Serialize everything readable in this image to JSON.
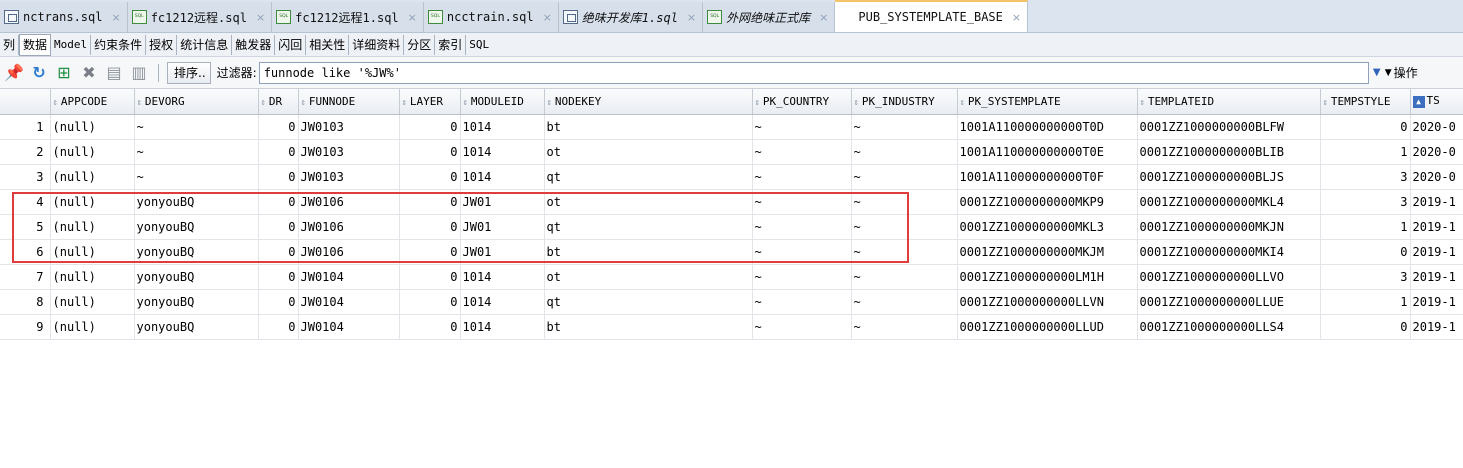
{
  "tabs": [
    {
      "label": "nctrans.sql",
      "icon": "doc-icon",
      "italic": false,
      "active": false
    },
    {
      "label": "fc1212远程.sql",
      "icon": "sql-icon",
      "italic": false,
      "active": false
    },
    {
      "label": "fc1212远程1.sql",
      "icon": "sql-icon",
      "italic": false,
      "active": false
    },
    {
      "label": "ncctrain.sql",
      "icon": "sql-icon",
      "italic": false,
      "active": false
    },
    {
      "label": "绝味开发库1.sql",
      "icon": "doc-icon",
      "italic": true,
      "active": false
    },
    {
      "label": "外网绝味正式库",
      "icon": "sql-icon",
      "italic": true,
      "active": false
    },
    {
      "label": "PUB_SYSTEMPLATE_BASE",
      "icon": "grid-icon",
      "italic": false,
      "active": true
    }
  ],
  "tab_close_glyph": "×",
  "subtabs": [
    "列",
    "数据",
    "Model",
    "约束条件",
    "授权",
    "统计信息",
    "触发器",
    "闪回",
    "相关性",
    "详细资料",
    "分区",
    "索引",
    "SQL"
  ],
  "toolbar": {
    "sort_label": "排序..",
    "filter_label": "过滤器:",
    "filter_value": "funnode like '%JW%'",
    "actions_label": "操作"
  },
  "grid": {
    "columns": [
      "APPCODE",
      "DEVORG",
      "DR",
      "FUNNODE",
      "LAYER",
      "MODULEID",
      "NODEKEY",
      "PK_COUNTRY",
      "PK_INDUSTRY",
      "PK_SYSTEMPLATE",
      "TEMPLATEID",
      "TEMPSTYLE",
      "TS"
    ],
    "rows": [
      {
        "n": "1",
        "cells": [
          "(null)",
          "~",
          "0",
          "JW0103",
          "0",
          "1014",
          "bt",
          "~",
          "~",
          "1001A110000000000T0D",
          "0001ZZ1000000000BLFW",
          "0",
          "2020-0"
        ]
      },
      {
        "n": "2",
        "cells": [
          "(null)",
          "~",
          "0",
          "JW0103",
          "0",
          "1014",
          "ot",
          "~",
          "~",
          "1001A110000000000T0E",
          "0001ZZ1000000000BLIB",
          "1",
          "2020-0"
        ]
      },
      {
        "n": "3",
        "cells": [
          "(null)",
          "~",
          "0",
          "JW0103",
          "0",
          "1014",
          "qt",
          "~",
          "~",
          "1001A110000000000T0F",
          "0001ZZ1000000000BLJS",
          "3",
          "2020-0"
        ]
      },
      {
        "n": "4",
        "cells": [
          "(null)",
          "yonyouBQ",
          "0",
          "JW0106",
          "0",
          "JW01",
          "ot",
          "~",
          "~",
          "0001ZZ1000000000MKP9",
          "0001ZZ1000000000MKL4",
          "3",
          "2019-1"
        ]
      },
      {
        "n": "5",
        "cells": [
          "(null)",
          "yonyouBQ",
          "0",
          "JW0106",
          "0",
          "JW01",
          "qt",
          "~",
          "~",
          "0001ZZ1000000000MKL3",
          "0001ZZ1000000000MKJN",
          "1",
          "2019-1"
        ]
      },
      {
        "n": "6",
        "cells": [
          "(null)",
          "yonyouBQ",
          "0",
          "JW0106",
          "0",
          "JW01",
          "bt",
          "~",
          "~",
          "0001ZZ1000000000MKJM",
          "0001ZZ1000000000MKI4",
          "0",
          "2019-1"
        ]
      },
      {
        "n": "7",
        "cells": [
          "(null)",
          "yonyouBQ",
          "0",
          "JW0104",
          "0",
          "1014",
          "ot",
          "~",
          "~",
          "0001ZZ1000000000LM1H",
          "0001ZZ1000000000LLVO",
          "3",
          "2019-1"
        ]
      },
      {
        "n": "8",
        "cells": [
          "(null)",
          "yonyouBQ",
          "0",
          "JW0104",
          "0",
          "1014",
          "qt",
          "~",
          "~",
          "0001ZZ1000000000LLVN",
          "0001ZZ1000000000LLUE",
          "1",
          "2019-1"
        ]
      },
      {
        "n": "9",
        "cells": [
          "(null)",
          "yonyouBQ",
          "0",
          "JW0104",
          "0",
          "1014",
          "bt",
          "~",
          "~",
          "0001ZZ1000000000LLUD",
          "0001ZZ1000000000LLS4",
          "0",
          "2019-1"
        ]
      }
    ]
  },
  "colors": {
    "highlight": "#e03c3c",
    "active_tab_accent": "#f5c36a"
  }
}
